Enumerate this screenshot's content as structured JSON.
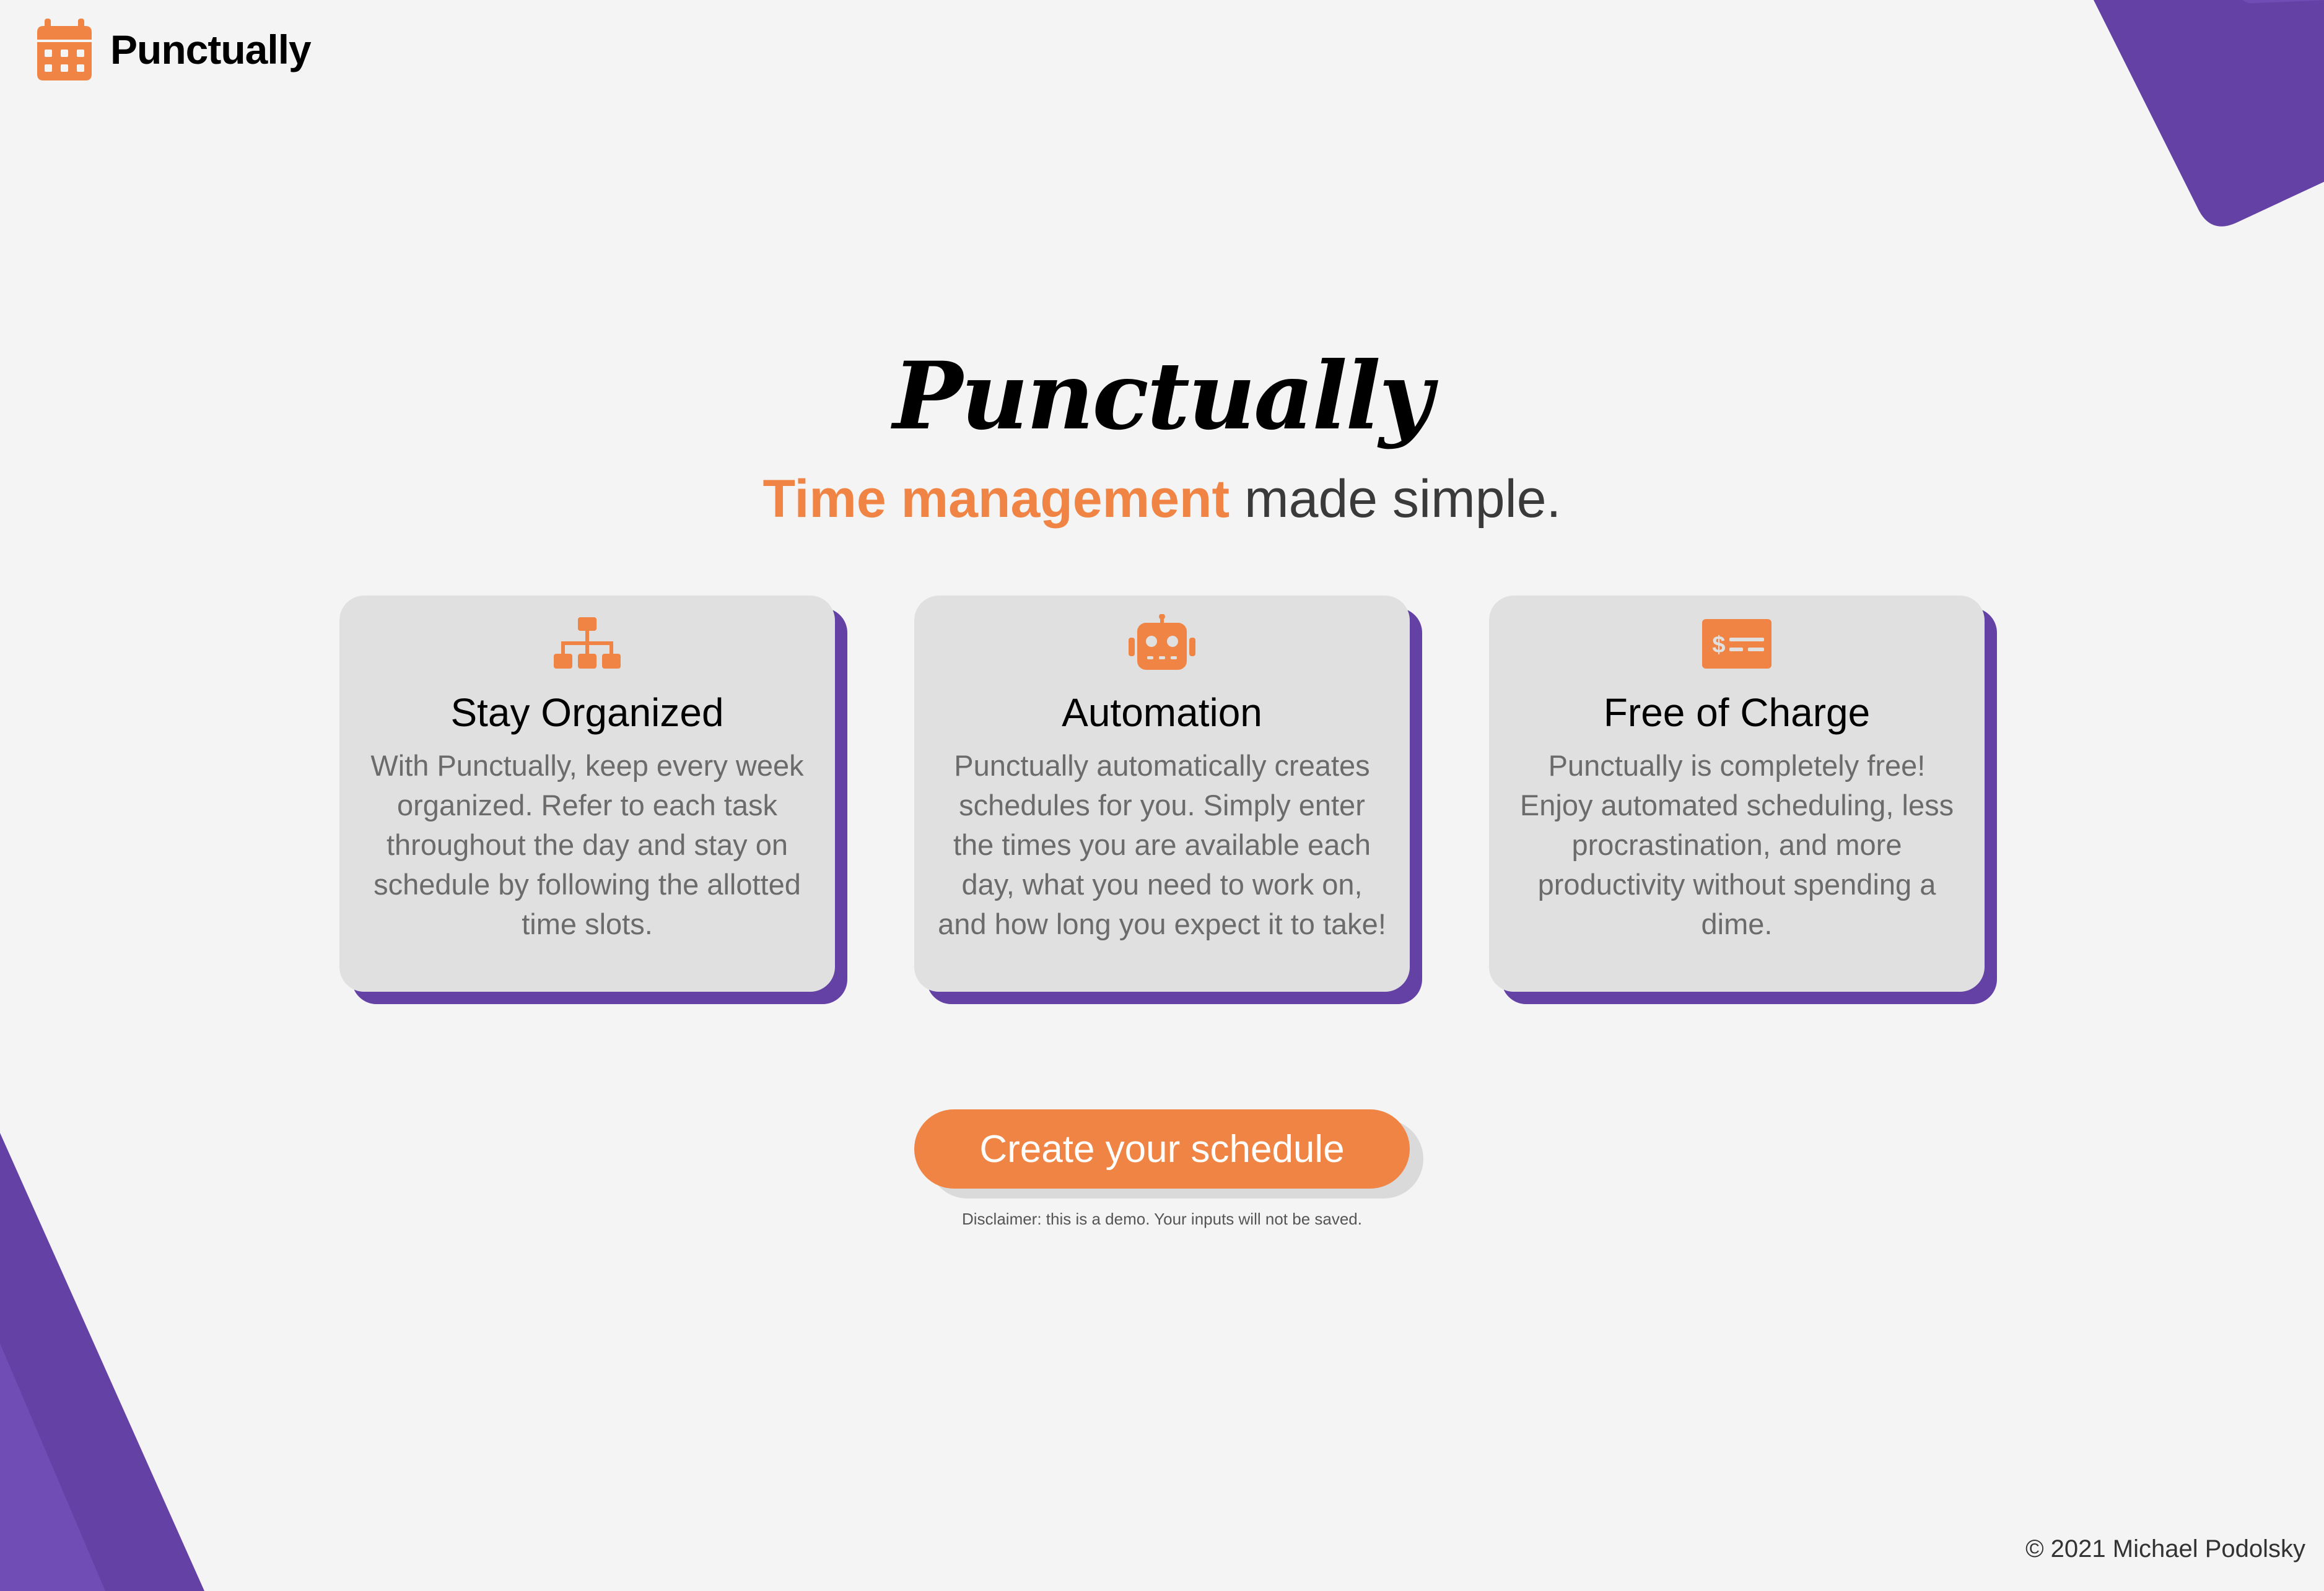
{
  "colors": {
    "background": "#f4f4f4",
    "accent_orange": "#f08444",
    "accent_purple": "#6441a5",
    "card_background": "#e0e0e0",
    "body_text": "#6b6b6b"
  },
  "nav": {
    "brand_icon": "calendar-icon",
    "brand_name": "Punctually"
  },
  "hero": {
    "title": "Punctually",
    "tagline_accent": "Time management",
    "tagline_rest": " made simple."
  },
  "features": [
    {
      "icon": "sitemap-icon",
      "title": "Stay Organized",
      "body": "With Punctually, keep every week organized. Refer to each task throughout the day and stay on schedule by following the allotted time slots."
    },
    {
      "icon": "robot-icon",
      "title": "Automation",
      "body": "Punctually automatically creates schedules for you. Simply enter the times you are available each day, what you need to work on, and how long you expect it to take!"
    },
    {
      "icon": "money-check-icon",
      "title": "Free of Charge",
      "body": "Punctually is completely free! Enjoy automated scheduling, less procrastination, and more productivity without spending a dime."
    }
  ],
  "cta": {
    "label": "Create your schedule",
    "disclaimer": "Disclaimer: this is a demo. Your inputs will not be saved."
  },
  "footer": {
    "copyright": "© 2021 Michael Podolsky"
  }
}
